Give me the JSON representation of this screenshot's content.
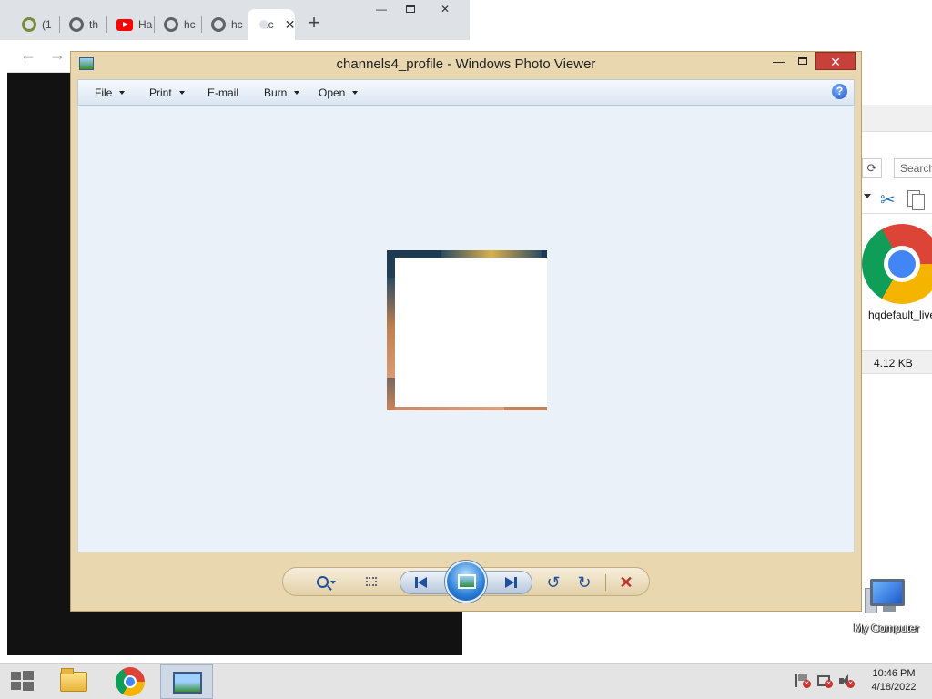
{
  "browser": {
    "tabs": [
      {
        "label": "(1",
        "icon": "gauge-icon"
      },
      {
        "label": "th",
        "icon": "globe-icon"
      },
      {
        "label": "Ha",
        "icon": "youtube-icon"
      },
      {
        "label": "hc",
        "icon": "globe-icon"
      },
      {
        "label": "hc",
        "icon": "globe-icon"
      },
      {
        "label": "hc",
        "icon": "globe-icon",
        "active": true
      }
    ],
    "new_tab_label": "+",
    "close_tab_label": "✕",
    "minimize_label": "—",
    "close_label": "✕"
  },
  "explorer": {
    "search_placeholder": "Search",
    "file_name": "hqdefault_live",
    "file_size": "4.12 KB"
  },
  "photo_viewer": {
    "title": "channels4_profile - Windows Photo Viewer",
    "menu": [
      {
        "label": "File",
        "has_dropdown": true
      },
      {
        "label": "Print",
        "has_dropdown": true
      },
      {
        "label": "E-mail",
        "has_dropdown": false
      },
      {
        "label": "Burn",
        "has_dropdown": true
      },
      {
        "label": "Open",
        "has_dropdown": true
      }
    ],
    "help_label": "?",
    "window_buttons": {
      "minimize": "—",
      "close": "✕"
    },
    "controls": {
      "rotate_left": "↺",
      "rotate_right": "↻",
      "delete": "✕"
    },
    "accent_color": "#c7413a",
    "frame_color": "#e9d7b0"
  },
  "desktop": {
    "my_computer_label": "My Computer"
  },
  "taskbar": {
    "items": [
      "file-explorer",
      "chrome",
      "photo-viewer"
    ],
    "active_item": "photo-viewer",
    "time": "10:46 PM",
    "date": "4/18/2022"
  }
}
